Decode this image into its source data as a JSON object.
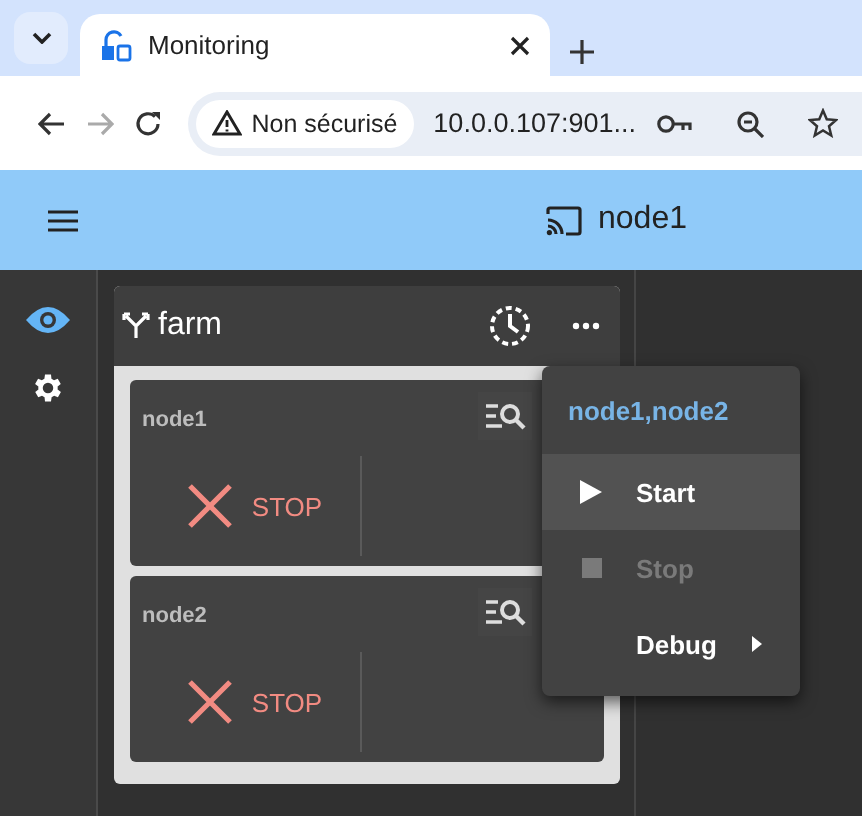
{
  "browser": {
    "tabs": [
      {
        "title": "Monitoring",
        "selected": true
      }
    ],
    "security_label": "Non sécurisé",
    "url": "10.0.0.107:901..."
  },
  "app_bar": {
    "title": "node1"
  },
  "nav": [
    {
      "kind": "view",
      "selected": true
    },
    {
      "kind": "settings",
      "selected": false
    }
  ],
  "group": {
    "name": "farm",
    "nodes": [
      {
        "name": "node1",
        "status": "STOP"
      },
      {
        "name": "node2",
        "status": "STOP"
      }
    ]
  },
  "menu": {
    "title": "node1,node2",
    "items": [
      {
        "kind": "start",
        "label": "Start",
        "selected": true,
        "disabled": false
      },
      {
        "kind": "stop",
        "label": "Stop",
        "selected": false,
        "disabled": true
      },
      {
        "kind": "submenu",
        "label": "Debug",
        "selected": false,
        "disabled": false
      }
    ]
  }
}
